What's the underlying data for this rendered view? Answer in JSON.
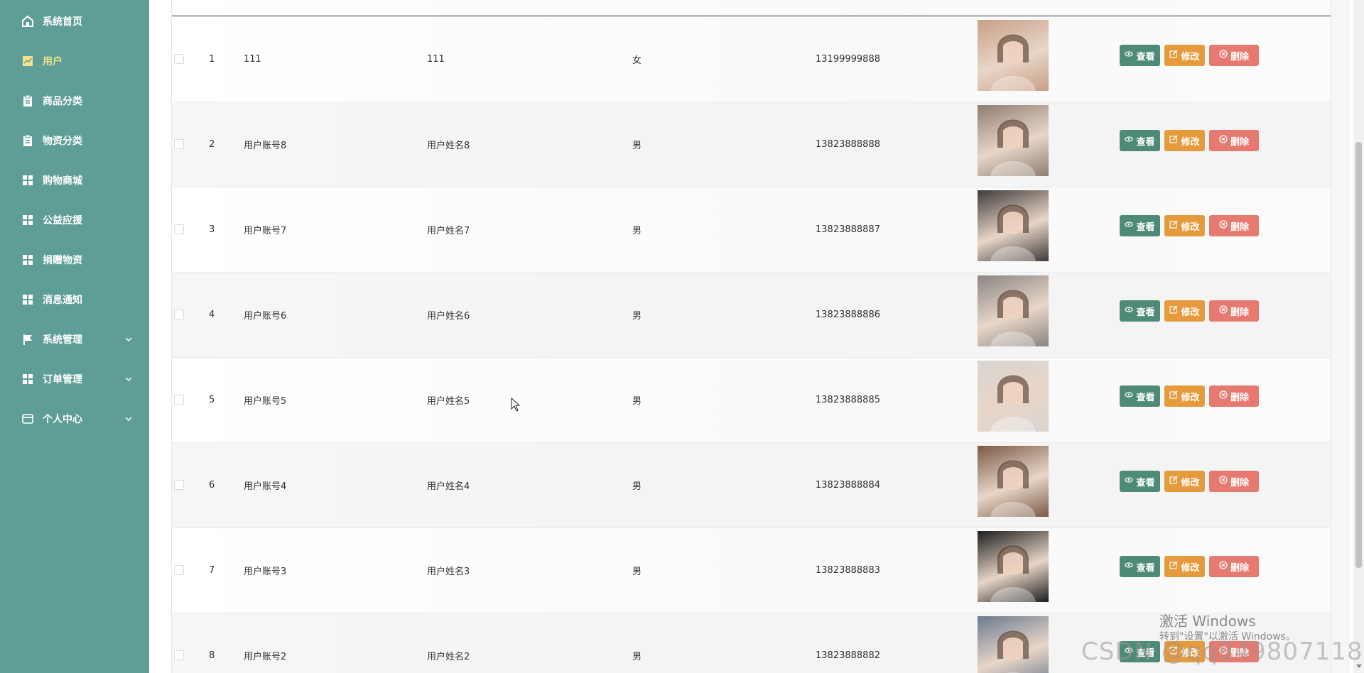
{
  "sidebar": {
    "items": [
      {
        "label": "系统首页",
        "icon": "home-icon"
      },
      {
        "label": "用户",
        "icon": "chart-icon",
        "active": true
      },
      {
        "label": "商品分类",
        "icon": "clipboard-icon"
      },
      {
        "label": "物资分类",
        "icon": "clipboard-icon"
      },
      {
        "label": "购物商城",
        "icon": "grid-icon"
      },
      {
        "label": "公益应援",
        "icon": "grid-icon"
      },
      {
        "label": "捐赠物资",
        "icon": "grid-icon"
      },
      {
        "label": "消息通知",
        "icon": "grid-icon"
      },
      {
        "label": "系统管理",
        "icon": "flag-icon",
        "expandable": true
      },
      {
        "label": "订单管理",
        "icon": "grid-icon",
        "expandable": true
      },
      {
        "label": "个人中心",
        "icon": "card-icon",
        "expandable": true
      }
    ]
  },
  "table": {
    "rows": [
      {
        "index": "1",
        "account": "111",
        "name": "111",
        "gender": "女",
        "phone": "13199999888"
      },
      {
        "index": "2",
        "account": "用户账号8",
        "name": "用户姓名8",
        "gender": "男",
        "phone": "13823888888"
      },
      {
        "index": "3",
        "account": "用户账号7",
        "name": "用户姓名7",
        "gender": "男",
        "phone": "13823888887"
      },
      {
        "index": "4",
        "account": "用户账号6",
        "name": "用户姓名6",
        "gender": "男",
        "phone": "13823888886"
      },
      {
        "index": "5",
        "account": "用户账号5",
        "name": "用户姓名5",
        "gender": "男",
        "phone": "13823888885"
      },
      {
        "index": "6",
        "account": "用户账号4",
        "name": "用户姓名4",
        "gender": "男",
        "phone": "13823888884"
      },
      {
        "index": "7",
        "account": "用户账号3",
        "name": "用户姓名3",
        "gender": "男",
        "phone": "13823888883"
      },
      {
        "index": "8",
        "account": "用户账号2",
        "name": "用户姓名2",
        "gender": "男",
        "phone": "13823888882"
      }
    ],
    "actions": {
      "view": "查看",
      "edit": "修改",
      "delete": "删除"
    }
  },
  "overlay": {
    "activate_title": "激活 Windows",
    "activate_sub": "转到\"设置\"以激活 Windows。",
    "csdn_watermark": "CSDN @qq849807118"
  },
  "colors": {
    "sidebar_bg": "#5f9e97",
    "view_btn": "#4e8a78",
    "edit_btn": "#e59a3c",
    "delete_btn": "#e77a70"
  }
}
